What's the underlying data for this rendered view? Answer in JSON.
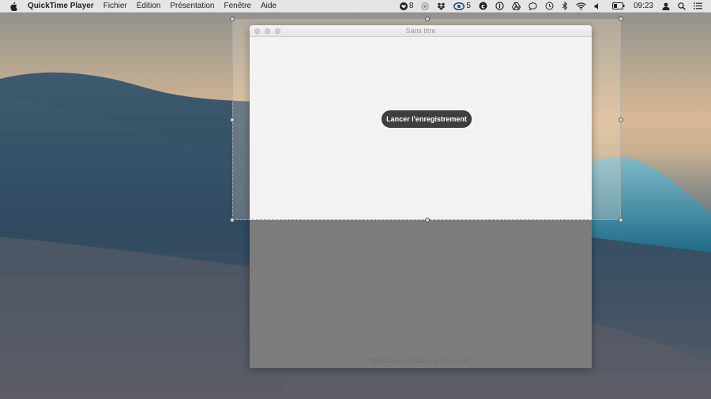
{
  "menubar": {
    "app_name": "QuickTime Player",
    "items": [
      "Fichier",
      "Édition",
      "Présentation",
      "Fenêtre",
      "Aide"
    ],
    "status": {
      "notification_count": "8",
      "sync_count": "5",
      "clock": "09:23"
    }
  },
  "window": {
    "title": "Sans titre",
    "status_line": "Markdown · 0 mots · 0 caractères"
  },
  "recording": {
    "start_button_label": "Lancer l'enregistrement"
  },
  "colors": {
    "menubar_bg": "#ececec",
    "button_bg": "#3f3f3f",
    "window_bg": "#f2f2f2",
    "shade": "#7c7c7c"
  }
}
